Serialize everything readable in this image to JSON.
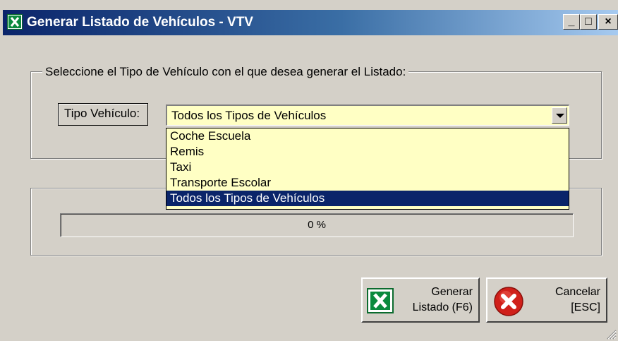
{
  "window": {
    "title": "Generar Listado de Vehículos - VTV",
    "controls": {
      "minimize": "_",
      "maximize": "□",
      "close": "×"
    }
  },
  "icons": {
    "app": "excel-icon",
    "generate": "excel-icon",
    "cancel": "error-x-icon"
  },
  "colors": {
    "titlebar_start": "#0a246a",
    "titlebar_end": "#a6caf0",
    "field_bg": "#ffffc4",
    "selection": "#0a246a",
    "cancel_red": "#d0201a",
    "excel_green": "#0b8a3e"
  },
  "group": {
    "legend": "Seleccione el Tipo de Vehículo con el que desea generar el Listado:"
  },
  "tipo": {
    "label": "Tipo Vehículo:",
    "selected": "Todos los Tipos de Vehículos",
    "options": [
      "Coche Escuela",
      "Remis",
      "Taxi",
      "Transporte Escolar",
      "Todos los Tipos de Vehículos"
    ],
    "highlighted_index": 4
  },
  "progress": {
    "value": 0,
    "text": "0 %"
  },
  "buttons": {
    "generate": {
      "line1": "Generar",
      "line2": "Listado (F6)"
    },
    "cancel": {
      "line1": "Cancelar",
      "line2": "[ESC]"
    }
  }
}
